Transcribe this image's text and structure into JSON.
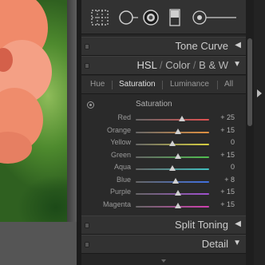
{
  "panels": {
    "tone_curve": "Tone Curve",
    "hsl": {
      "hsl": "HSL",
      "sep": "/",
      "color": "Color",
      "bw": "B & W"
    },
    "split_toning": "Split Toning",
    "detail": "Detail"
  },
  "hsl_tabs": [
    "Hue",
    "Saturation",
    "Luminance",
    "All"
  ],
  "active_tab": "Saturation",
  "section_title": "Saturation",
  "sliders": [
    {
      "label": "Red",
      "value": "+ 25",
      "amount": 25,
      "color": "#e05050"
    },
    {
      "label": "Orange",
      "value": "+ 15",
      "amount": 15,
      "color": "#e09040"
    },
    {
      "label": "Yellow",
      "value": "0",
      "amount": 0,
      "color": "#d8d040"
    },
    {
      "label": "Green",
      "value": "+ 15",
      "amount": 15,
      "color": "#50c050"
    },
    {
      "label": "Aqua",
      "value": "0",
      "amount": 0,
      "color": "#40c0c0"
    },
    {
      "label": "Blue",
      "value": "+ 8",
      "amount": 8,
      "color": "#4070e0"
    },
    {
      "label": "Purple",
      "value": "+ 15",
      "amount": 15,
      "color": "#a050d0"
    },
    {
      "label": "Magenta",
      "value": "+ 15",
      "amount": 15,
      "color": "#d040b0"
    }
  ],
  "colors": {
    "panel_bg": "#262626",
    "header_bg": "#323232",
    "text": "#cccccc"
  },
  "icons": [
    "crop-overlay-icon",
    "spot-removal-icon",
    "red-eye-icon",
    "graduated-filter-icon",
    "adjustment-brush-icon"
  ]
}
